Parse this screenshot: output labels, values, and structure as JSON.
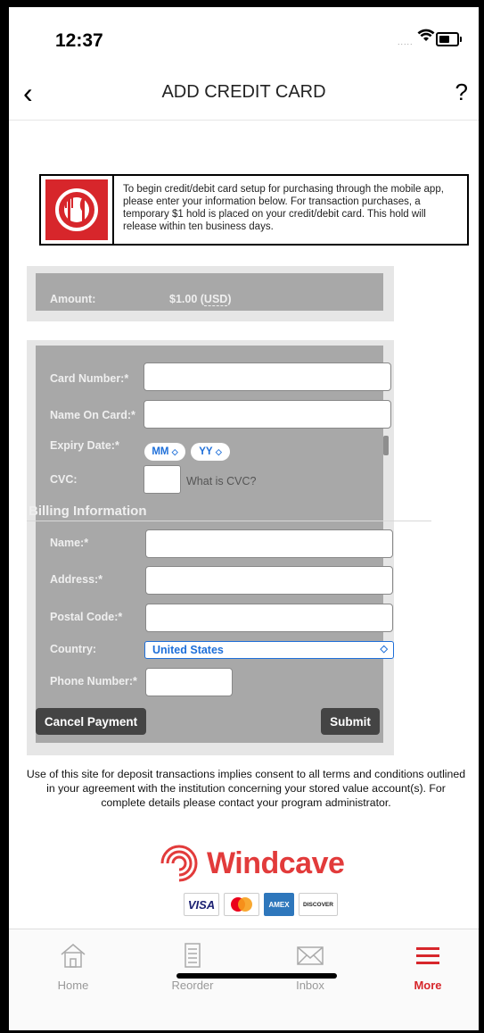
{
  "status": {
    "time": "12:37",
    "signal": "....."
  },
  "nav": {
    "back": "‹",
    "title": "ADD CREDIT CARD",
    "help": "?"
  },
  "notice": {
    "text": "To begin credit/debit card setup for purchasing through the mobile app, please enter your information below. For transaction purchases, a temporary $1 hold is placed on your credit/debit card. This hold will release within ten business days.",
    "logo_icon": "restaurant-plate-icon"
  },
  "amount": {
    "label": "Amount:",
    "value": "$1.00",
    "currency": "USD"
  },
  "card": {
    "number_label": "Card Number:*",
    "name_label": "Name On Card:*",
    "expiry_label": "Expiry Date:*",
    "month_placeholder": "MM",
    "year_placeholder": "YY",
    "cvc_label": "CVC:",
    "cvc_help": "What is CVC?"
  },
  "billing": {
    "heading": "Billing Information",
    "name_label": "Name:*",
    "address_label": "Address:*",
    "postal_label": "Postal Code:*",
    "country_label": "Country:",
    "country_value": "United States",
    "phone_label": "Phone Number:*"
  },
  "buttons": {
    "cancel": "Cancel Payment",
    "submit": "Submit"
  },
  "consent": "Use of this site for deposit transactions implies consent to all terms and conditions outlined in your agreement with the institution concerning your stored value account(s). For complete details please contact your program administrator.",
  "brand": {
    "name": "Windcave",
    "color": "#e23b3b"
  },
  "card_logos": {
    "visa": "VISA",
    "amex": "AMEX",
    "discover": "DISCOVER"
  },
  "tabs": [
    {
      "label": "Home",
      "icon": "home-icon"
    },
    {
      "label": "Reorder",
      "icon": "receipt-icon"
    },
    {
      "label": "Inbox",
      "icon": "envelope-icon"
    },
    {
      "label": "More",
      "icon": "menu-icon"
    }
  ],
  "colors": {
    "accent": "#d7262b",
    "link": "#1e6fd9",
    "panel": "#a8a8a8"
  }
}
